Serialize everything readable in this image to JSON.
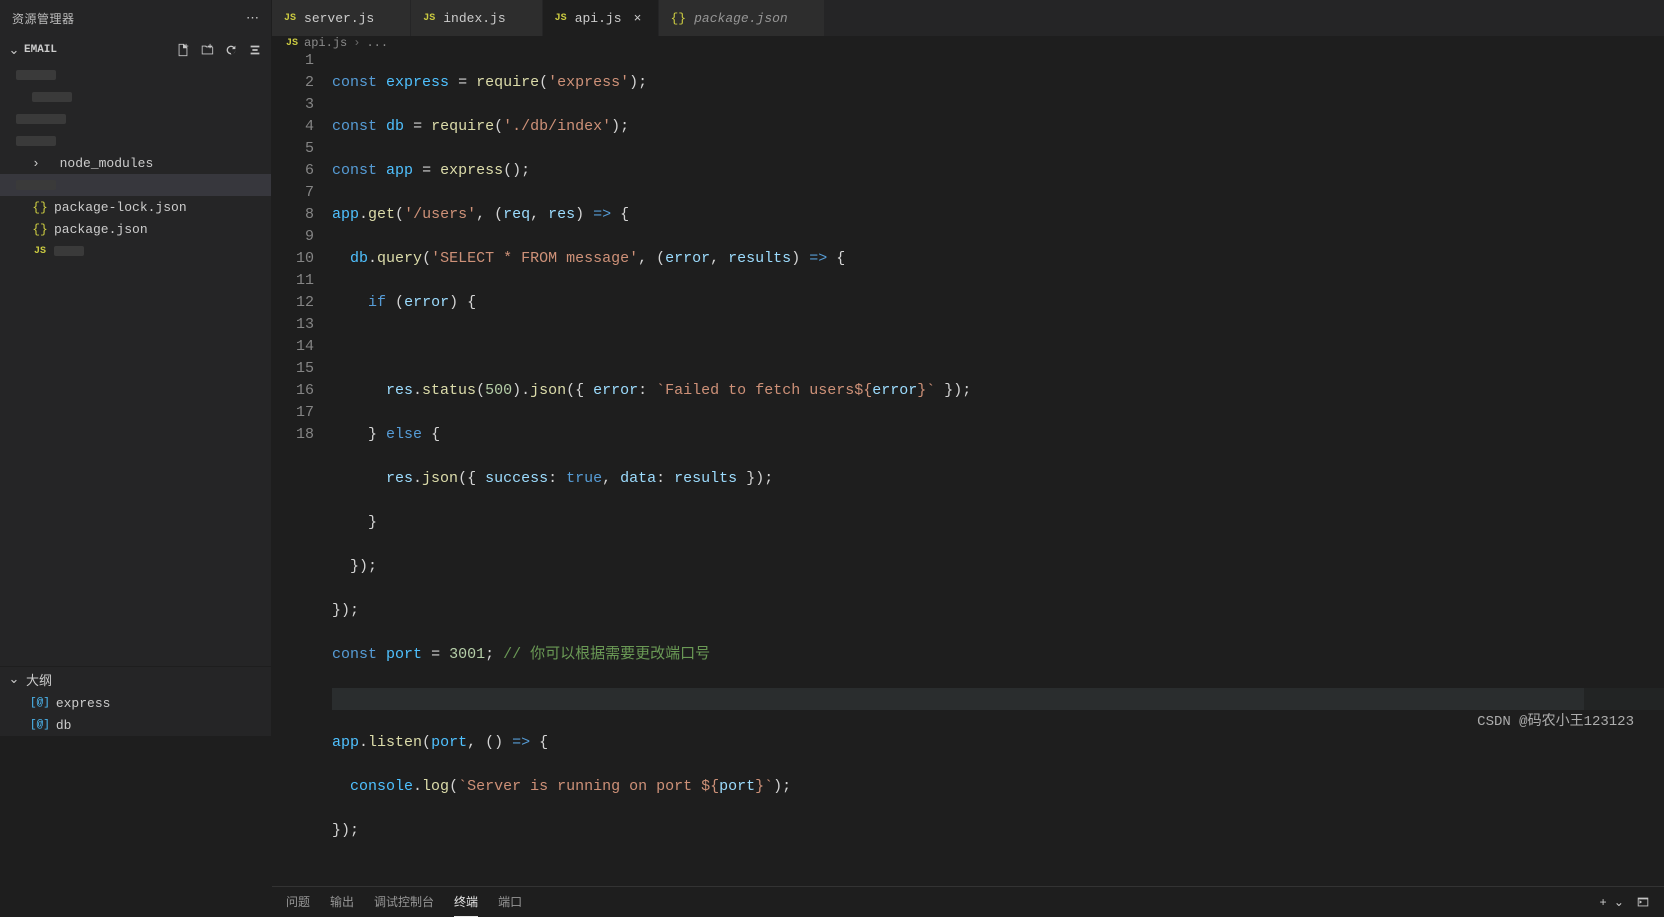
{
  "sidebar": {
    "title": "资源管理器",
    "section": "EMAIL",
    "actions": {
      "newFile": "new-file",
      "newFolder": "new-folder",
      "refresh": "refresh",
      "collapse": "collapse"
    },
    "tree": [
      {
        "type": "dim",
        "indent": 0
      },
      {
        "type": "dim",
        "indent": 1
      },
      {
        "type": "dim",
        "indent": 0
      },
      {
        "type": "dim",
        "indent": 0
      },
      {
        "type": "folder",
        "label": "node_modules",
        "indent": 0,
        "chev": ">"
      },
      {
        "type": "dim",
        "indent": 0,
        "active": true
      },
      {
        "type": "file",
        "label": "package-lock.json",
        "icon": "json"
      },
      {
        "type": "file",
        "label": "package.json",
        "icon": "json"
      },
      {
        "type": "file",
        "label": "",
        "icon": "js"
      }
    ],
    "outline": {
      "label": "大纲",
      "items": [
        {
          "icon": "[@]",
          "name": "express"
        },
        {
          "icon": "[@]",
          "name": "db"
        }
      ]
    }
  },
  "tabs": [
    {
      "icon": "JS",
      "name": "server.js",
      "active": false,
      "italic": false
    },
    {
      "icon": "JS",
      "name": "index.js",
      "active": false,
      "italic": false
    },
    {
      "icon": "JS",
      "name": "api.js",
      "active": true,
      "italic": false,
      "closable": true
    },
    {
      "icon": "{}",
      "name": "package.json",
      "active": false,
      "italic": true
    }
  ],
  "breadcrumb": {
    "file": "api.js",
    "icon": "JS",
    "more": "..."
  },
  "code": {
    "lines": [
      1,
      2,
      3,
      4,
      5,
      6,
      7,
      8,
      9,
      10,
      11,
      12,
      13,
      14,
      15,
      16,
      17,
      18
    ],
    "hl": 15
  },
  "panel": {
    "tabs": [
      "问题",
      "输出",
      "调试控制台",
      "终端",
      "端口"
    ],
    "active": "终端"
  },
  "watermark": "CSDN @码农小王123123",
  "strings": {
    "express": "express",
    "require": "require",
    "dbpath": "'./db/index'",
    "expstr": "'express'",
    "users": "'/users'",
    "select": "'SELECT * FROM message'",
    "failed": "`Failed to fetch users${",
    "closebt": "}`",
    "srvmsg": "`Server is running on port ${",
    "closebt2": "}`",
    "comment": "// 你可以根据需要更改端口号",
    "port": "3001",
    "n500": "500",
    "true": "true"
  }
}
